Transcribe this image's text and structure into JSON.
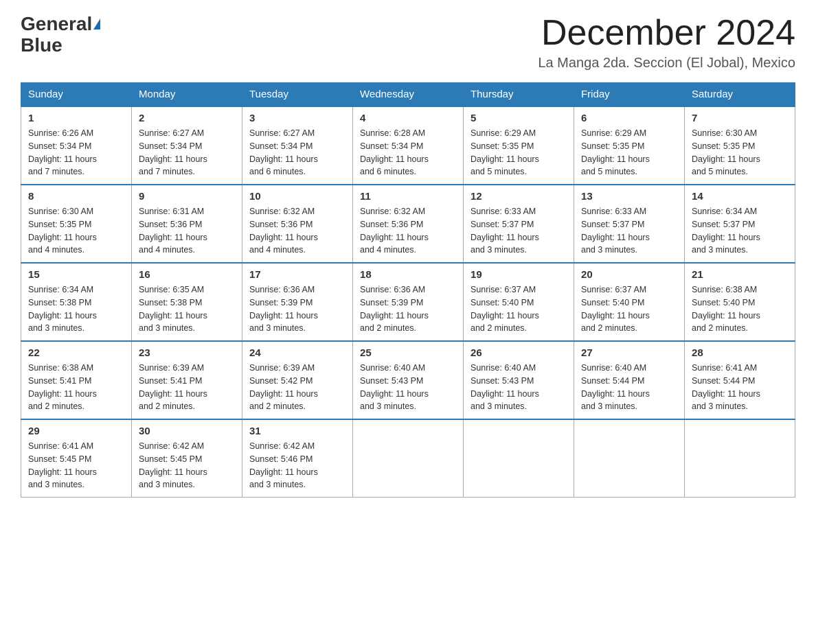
{
  "header": {
    "logo_general": "General",
    "logo_blue": "Blue",
    "month_title": "December 2024",
    "location": "La Manga 2da. Seccion (El Jobal), Mexico"
  },
  "weekdays": [
    "Sunday",
    "Monday",
    "Tuesday",
    "Wednesday",
    "Thursday",
    "Friday",
    "Saturday"
  ],
  "weeks": [
    [
      {
        "day": "1",
        "sunrise": "6:26 AM",
        "sunset": "5:34 PM",
        "daylight": "11 hours and 7 minutes."
      },
      {
        "day": "2",
        "sunrise": "6:27 AM",
        "sunset": "5:34 PM",
        "daylight": "11 hours and 7 minutes."
      },
      {
        "day": "3",
        "sunrise": "6:27 AM",
        "sunset": "5:34 PM",
        "daylight": "11 hours and 6 minutes."
      },
      {
        "day": "4",
        "sunrise": "6:28 AM",
        "sunset": "5:34 PM",
        "daylight": "11 hours and 6 minutes."
      },
      {
        "day": "5",
        "sunrise": "6:29 AM",
        "sunset": "5:35 PM",
        "daylight": "11 hours and 5 minutes."
      },
      {
        "day": "6",
        "sunrise": "6:29 AM",
        "sunset": "5:35 PM",
        "daylight": "11 hours and 5 minutes."
      },
      {
        "day": "7",
        "sunrise": "6:30 AM",
        "sunset": "5:35 PM",
        "daylight": "11 hours and 5 minutes."
      }
    ],
    [
      {
        "day": "8",
        "sunrise": "6:30 AM",
        "sunset": "5:35 PM",
        "daylight": "11 hours and 4 minutes."
      },
      {
        "day": "9",
        "sunrise": "6:31 AM",
        "sunset": "5:36 PM",
        "daylight": "11 hours and 4 minutes."
      },
      {
        "day": "10",
        "sunrise": "6:32 AM",
        "sunset": "5:36 PM",
        "daylight": "11 hours and 4 minutes."
      },
      {
        "day": "11",
        "sunrise": "6:32 AM",
        "sunset": "5:36 PM",
        "daylight": "11 hours and 4 minutes."
      },
      {
        "day": "12",
        "sunrise": "6:33 AM",
        "sunset": "5:37 PM",
        "daylight": "11 hours and 3 minutes."
      },
      {
        "day": "13",
        "sunrise": "6:33 AM",
        "sunset": "5:37 PM",
        "daylight": "11 hours and 3 minutes."
      },
      {
        "day": "14",
        "sunrise": "6:34 AM",
        "sunset": "5:37 PM",
        "daylight": "11 hours and 3 minutes."
      }
    ],
    [
      {
        "day": "15",
        "sunrise": "6:34 AM",
        "sunset": "5:38 PM",
        "daylight": "11 hours and 3 minutes."
      },
      {
        "day": "16",
        "sunrise": "6:35 AM",
        "sunset": "5:38 PM",
        "daylight": "11 hours and 3 minutes."
      },
      {
        "day": "17",
        "sunrise": "6:36 AM",
        "sunset": "5:39 PM",
        "daylight": "11 hours and 3 minutes."
      },
      {
        "day": "18",
        "sunrise": "6:36 AM",
        "sunset": "5:39 PM",
        "daylight": "11 hours and 2 minutes."
      },
      {
        "day": "19",
        "sunrise": "6:37 AM",
        "sunset": "5:40 PM",
        "daylight": "11 hours and 2 minutes."
      },
      {
        "day": "20",
        "sunrise": "6:37 AM",
        "sunset": "5:40 PM",
        "daylight": "11 hours and 2 minutes."
      },
      {
        "day": "21",
        "sunrise": "6:38 AM",
        "sunset": "5:40 PM",
        "daylight": "11 hours and 2 minutes."
      }
    ],
    [
      {
        "day": "22",
        "sunrise": "6:38 AM",
        "sunset": "5:41 PM",
        "daylight": "11 hours and 2 minutes."
      },
      {
        "day": "23",
        "sunrise": "6:39 AM",
        "sunset": "5:41 PM",
        "daylight": "11 hours and 2 minutes."
      },
      {
        "day": "24",
        "sunrise": "6:39 AM",
        "sunset": "5:42 PM",
        "daylight": "11 hours and 2 minutes."
      },
      {
        "day": "25",
        "sunrise": "6:40 AM",
        "sunset": "5:43 PM",
        "daylight": "11 hours and 3 minutes."
      },
      {
        "day": "26",
        "sunrise": "6:40 AM",
        "sunset": "5:43 PM",
        "daylight": "11 hours and 3 minutes."
      },
      {
        "day": "27",
        "sunrise": "6:40 AM",
        "sunset": "5:44 PM",
        "daylight": "11 hours and 3 minutes."
      },
      {
        "day": "28",
        "sunrise": "6:41 AM",
        "sunset": "5:44 PM",
        "daylight": "11 hours and 3 minutes."
      }
    ],
    [
      {
        "day": "29",
        "sunrise": "6:41 AM",
        "sunset": "5:45 PM",
        "daylight": "11 hours and 3 minutes."
      },
      {
        "day": "30",
        "sunrise": "6:42 AM",
        "sunset": "5:45 PM",
        "daylight": "11 hours and 3 minutes."
      },
      {
        "day": "31",
        "sunrise": "6:42 AM",
        "sunset": "5:46 PM",
        "daylight": "11 hours and 3 minutes."
      },
      null,
      null,
      null,
      null
    ]
  ],
  "labels": {
    "sunrise": "Sunrise:",
    "sunset": "Sunset:",
    "daylight": "Daylight:"
  }
}
